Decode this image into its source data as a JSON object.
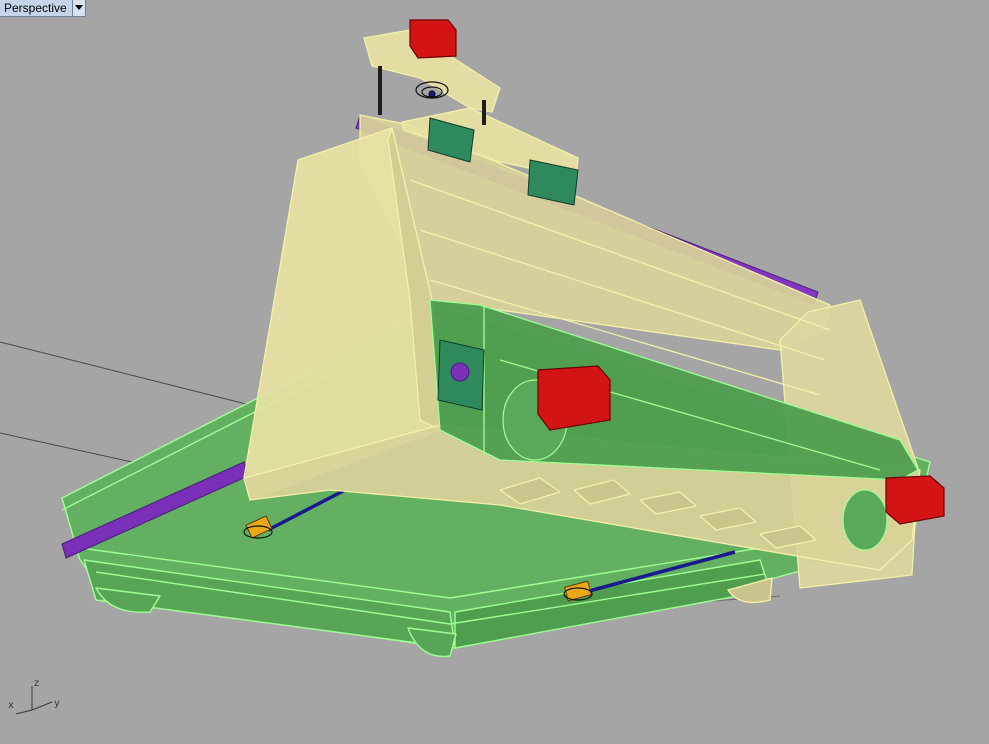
{
  "viewport": {
    "title": "Perspective",
    "background": "#a5a5a5"
  },
  "axes": {
    "x": "x",
    "y": "y",
    "z": "z"
  },
  "colors": {
    "frame": "#e8e2a4",
    "frame_edge": "#f4f0a8",
    "base": "#63b063",
    "base_edge": "#9dff92",
    "motor": "#d41414",
    "rail": "#7a2fb8",
    "bearing_block": "#2e8a5c",
    "leadscrew": "#1a1a8c",
    "coupler": "#e8a818"
  },
  "icons": {
    "menu": "triangle-down-icon",
    "axes": "axis-gizmo-icon"
  }
}
